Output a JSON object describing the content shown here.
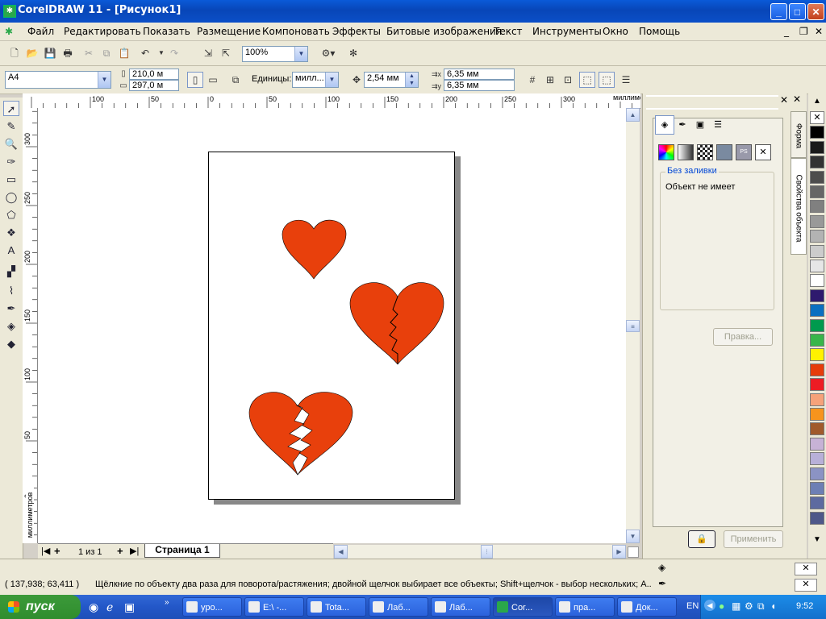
{
  "window": {
    "title": "CorelDRAW 11 - [Рисунок1]",
    "minimize": "_",
    "maximize": "□",
    "close": "✕"
  },
  "menu": [
    "Файл",
    "Редактировать",
    "Показать",
    "Размещение",
    "Компоновать",
    "Эффекты",
    "Битовые изображения",
    "Текст",
    "Инструменты",
    "Окно",
    "Помощь"
  ],
  "mdi_controls": {
    "minimize": "_",
    "restore": "❐",
    "close": "✕"
  },
  "toolbar": {
    "zoom": "100%"
  },
  "property_bar": {
    "page_size": "A4",
    "width": "210,0 м",
    "height": "297,0 м",
    "units_label": "Единицы:",
    "units": "милл...",
    "nudge": "2,54 мм",
    "dup_x": "6,35 мм",
    "dup_y": "6,35 мм"
  },
  "rulers": {
    "h_labels": [
      "100",
      "50",
      "0",
      "50",
      "100",
      "150",
      "200",
      "250",
      "300"
    ],
    "v_labels": [
      "300",
      "250",
      "200",
      "150",
      "100",
      "50",
      "0"
    ],
    "unit": "миллиметров"
  },
  "page_nav": {
    "counter": "1 из 1",
    "tab": "Страница 1"
  },
  "docker": {
    "fill_section_title": "Без заливки",
    "fill_text": "Объект не имеет",
    "edit_button": "Правка...",
    "apply_button": "Применить",
    "tab_shape": "Форма",
    "tab_properties": "Свойства объекта"
  },
  "palette": [
    "#ffffff",
    "#000000",
    "#1a1a1a",
    "#333333",
    "#4d4d4d",
    "#666666",
    "#808080",
    "#999999",
    "#b3b3b3",
    "#cccccc",
    "#e6e6e6",
    "#ffffff",
    "#2e1a6e",
    "#0a6fc0",
    "#009a4e",
    "#39b54a",
    "#fff200",
    "#e63c0a",
    "#ed1c24",
    "#f6a27a",
    "#f7941d",
    "#a05a2c",
    "#c7b2d6",
    "#b8b0d8",
    "#8b93c4",
    "#6d7fb4",
    "#5d6aa0",
    "#4e5889"
  ],
  "heart_color": "#e8400c",
  "status": {
    "coords": "( 137,938; 63,411 )",
    "hint": "Щёлкние по объекту два раза для поворота/растяжения; двойной щелчок выбирает все объекты; Shift+щелчок - выбор нескольких; A..."
  },
  "taskbar": {
    "start": "пуск",
    "tasks": [
      "уро...",
      "E:\\ -...",
      "Tota...",
      "Лаб...",
      "Лаб...",
      "Cor...",
      "пра...",
      "Док..."
    ],
    "lang": "EN",
    "clock": "9:52"
  }
}
